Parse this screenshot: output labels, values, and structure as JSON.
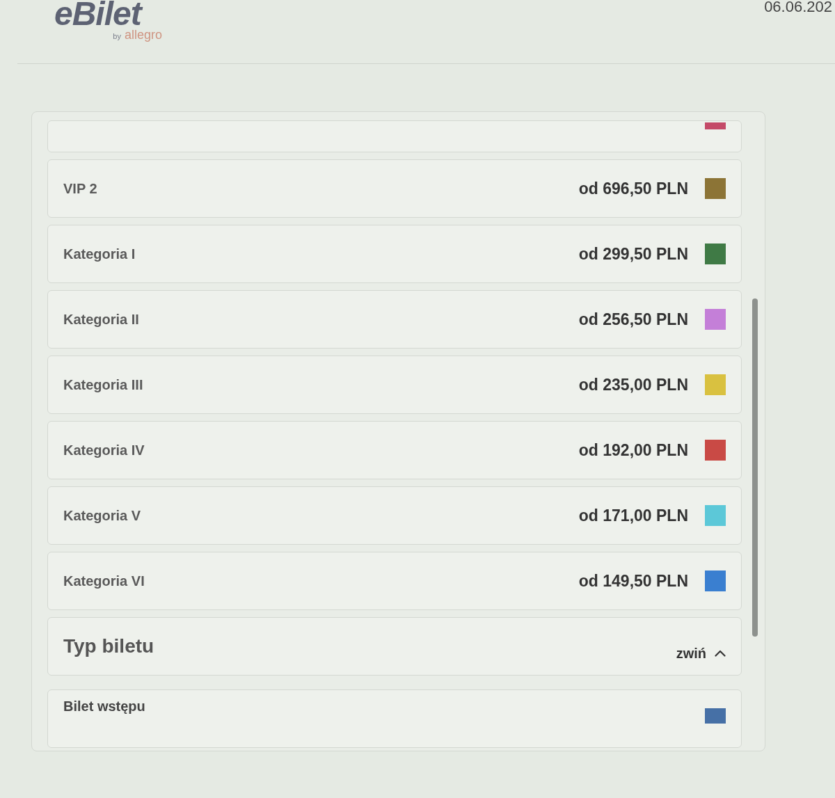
{
  "header": {
    "logo": "eBilet",
    "logo_by": "by",
    "logo_brand": "allegro",
    "date": "06.06.202"
  },
  "price_categories": [
    {
      "kind": "partial",
      "color": "#c44a68"
    },
    {
      "kind": "full",
      "name": "VIP 2",
      "price": "od 696,50 PLN",
      "color": "#8c7436"
    },
    {
      "kind": "full",
      "name": "Kategoria I",
      "price": "od 299,50 PLN",
      "color": "#3f7a45"
    },
    {
      "kind": "full",
      "name": "Kategoria II",
      "price": "od 256,50 PLN",
      "color": "#c47fd8"
    },
    {
      "kind": "full",
      "name": "Kategoria III",
      "price": "od 235,00 PLN",
      "color": "#d9c140"
    },
    {
      "kind": "full",
      "name": "Kategoria IV",
      "price": "od 192,00 PLN",
      "color": "#c94a45"
    },
    {
      "kind": "full",
      "name": "Kategoria V",
      "price": "od 171,00 PLN",
      "color": "#5cc8d8"
    },
    {
      "kind": "full",
      "name": "Kategoria VI",
      "price": "od 149,50 PLN",
      "color": "#3a7fd0"
    }
  ],
  "ticket_type_section": {
    "title": "Typ biletu",
    "toggle_label": "zwiń",
    "expanded": true,
    "items": [
      {
        "name": "Bilet wstępu",
        "color": "#4670a6"
      }
    ]
  }
}
